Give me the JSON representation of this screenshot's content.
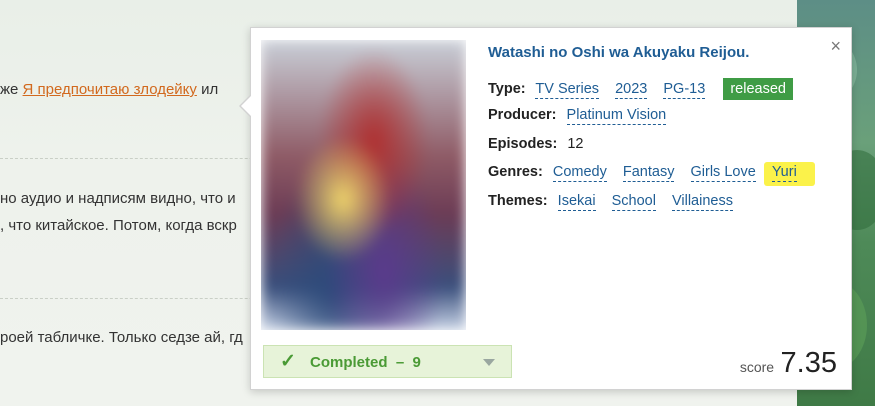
{
  "background": {
    "line1_prefix": "же ",
    "line1_link": "Я предпочитаю злодейку",
    "line1_suffix": " ил",
    "line2": "но аудио и надписям видно, что и",
    "line3": ", что китайское. Потом, когда вскр",
    "line4": "роей табличке. Только седзе ай, гд"
  },
  "popup": {
    "close_symbol": "×",
    "title": "Watashi no Oshi wa Akuyaku Reijou.",
    "type": {
      "label": "Type:",
      "kind": "TV Series",
      "year": "2023",
      "rating": "PG-13",
      "status": "released"
    },
    "producer": {
      "label": "Producer:",
      "values": [
        "Platinum Vision"
      ]
    },
    "episodes": {
      "label": "Episodes:",
      "value": "12"
    },
    "genres": {
      "label": "Genres:",
      "values": [
        "Comedy",
        "Fantasy",
        "Girls Love",
        "Yuri"
      ]
    },
    "themes": {
      "label": "Themes:",
      "values": [
        "Isekai",
        "School",
        "Villainess"
      ]
    },
    "list_status": {
      "check_symbol": "✓",
      "text": "Completed  –  9"
    },
    "score": {
      "label": "score",
      "value": "7.35"
    }
  },
  "colors": {
    "link": "#1f5d94",
    "released_badge": "#3f9c45",
    "completed": "#4a9a35",
    "highlight": "#fbf24a"
  }
}
